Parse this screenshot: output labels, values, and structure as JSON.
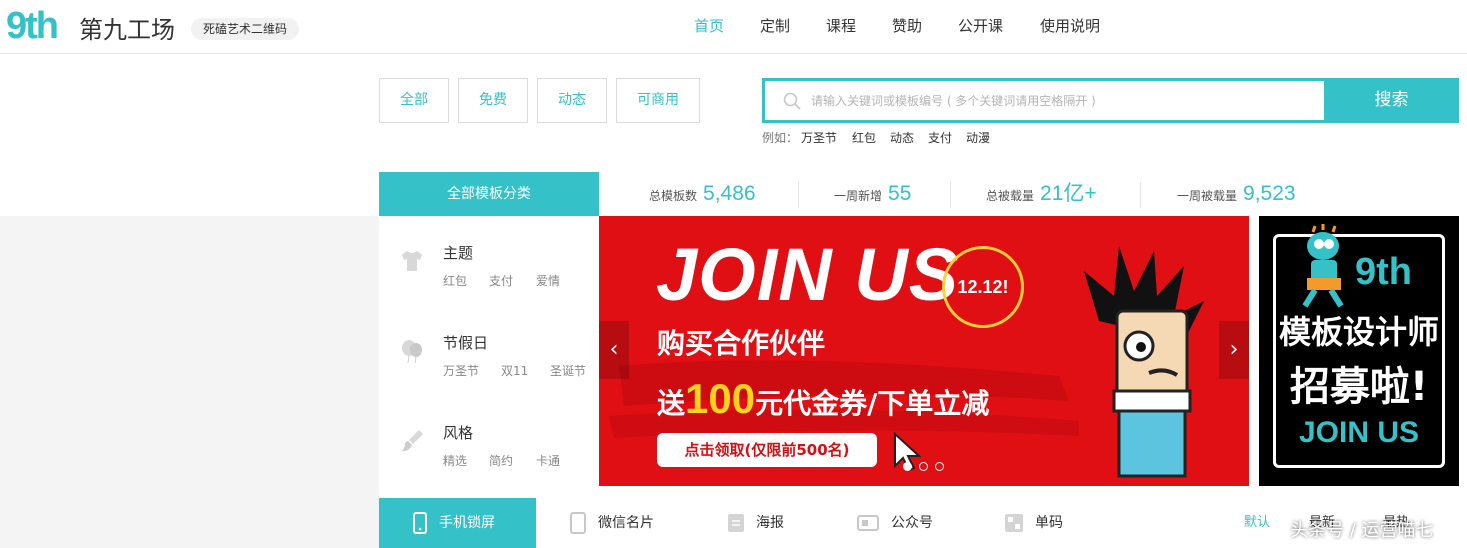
{
  "brand": {
    "logo": "9th",
    "name": "第九工场",
    "slogan": "死磕艺术二维码"
  },
  "nav": [
    {
      "label": "首页",
      "active": true
    },
    {
      "label": "定制"
    },
    {
      "label": "课程"
    },
    {
      "label": "赞助"
    },
    {
      "label": "公开课"
    },
    {
      "label": "使用说明"
    }
  ],
  "filters": [
    "全部",
    "免费",
    "动态",
    "可商用"
  ],
  "search": {
    "placeholder": "请输入关键词或模板编号 ( 多个关键词请用空格隔开 )",
    "button": "搜索",
    "hot_label": "例如：",
    "hot": [
      "万圣节",
      "红包",
      "动态",
      "支付",
      "动漫"
    ]
  },
  "categories_header": "全部模板分类",
  "stats": [
    {
      "label": "总模板数",
      "value": "5,486"
    },
    {
      "label": "一周新增",
      "value": "55"
    },
    {
      "label": "总被载量",
      "value": "21亿+"
    },
    {
      "label": "一周被载量",
      "value": "9,523"
    }
  ],
  "categories": [
    {
      "title": "主题",
      "icon": "shirt-icon",
      "subs": [
        "红包",
        "支付",
        "爱情"
      ]
    },
    {
      "title": "节假日",
      "icon": "balloon-icon",
      "subs": [
        "万圣节",
        "双11",
        "圣诞节"
      ]
    },
    {
      "title": "风格",
      "icon": "brush-icon",
      "subs": [
        "精选",
        "简约",
        "卡通"
      ]
    }
  ],
  "banner": {
    "headline": "JOIN US",
    "line1": "购买合作伙伴",
    "line2_pre": "送",
    "line2_big": "100",
    "line2_post": "元代金券/下单立减",
    "cta": "点击领取(仅限前500名)",
    "badge": "12.12!",
    "prev": "‹",
    "next": "›",
    "slides": 3,
    "active_slide": 1
  },
  "side_ad": {
    "logo": "9th",
    "line1": "模板设计师",
    "line2": "招募啦!",
    "line3": "JOIN US"
  },
  "tabs": [
    {
      "label": "手机锁屏",
      "icon": "phone-icon",
      "active": true
    },
    {
      "label": "微信名片",
      "icon": "card-icon"
    },
    {
      "label": "海报",
      "icon": "poster-icon"
    },
    {
      "label": "公众号",
      "icon": "account-icon"
    },
    {
      "label": "单码",
      "icon": "qrcode-icon"
    }
  ],
  "sort": [
    "默认",
    "最新",
    "最热"
  ],
  "watermark": "头条号 / 运营喵七",
  "colors": {
    "accent": "#35c1c8",
    "banner_red": "#e00f14",
    "yellow": "#ffd21e"
  }
}
